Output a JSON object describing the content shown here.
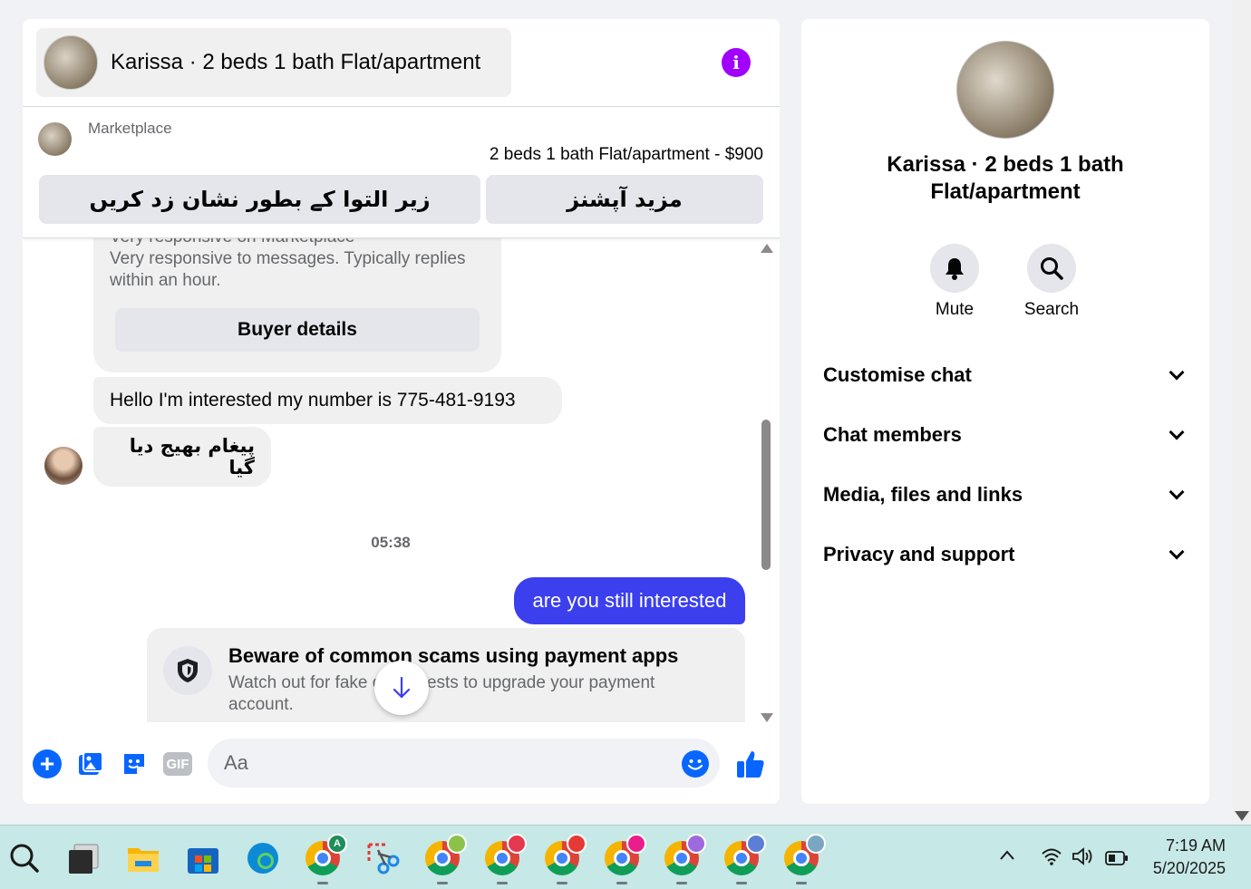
{
  "chat": {
    "header_title": "Karissa · 2 beds 1 bath Flat/apartment",
    "listing": {
      "source_label": "Marketplace",
      "title_price": "2 beds 1 bath Flat/apartment - $900",
      "mark_sold_label": "زیر التوا کے بطور نشان زد کریں",
      "more_options_label": "مزید آپشنز"
    },
    "seller_card": {
      "cut_line": "Very responsive on Marketplace",
      "responsiveness": "Very responsive to messages. Typically replies within an hour.",
      "buyer_details_label": "Buyer details"
    },
    "messages": [
      {
        "from": "them",
        "text": "Hello I'm interested my number is 775-481-9193"
      },
      {
        "from": "them",
        "text": "پیغام بھیج دیا گیا"
      }
    ],
    "timestamp": "05:38",
    "my_message": "are you still interested",
    "scam_warning": {
      "title": "Beware of common scams using payment apps",
      "text": "Watch out for fake      or requests to upgrade your payment account."
    },
    "composer": {
      "placeholder": "Aa",
      "gif_label": "GIF"
    }
  },
  "info_panel": {
    "title": "Karissa · 2 beds 1 bath Flat/apartment",
    "actions": [
      {
        "label": "Mute",
        "icon": "bell-icon"
      },
      {
        "label": "Search",
        "icon": "search-icon"
      }
    ],
    "sections": [
      "Customise chat",
      "Chat members",
      "Media, files and links",
      "Privacy and support"
    ]
  },
  "taskbar": {
    "time": "7:19 AM",
    "date": "5/20/2025",
    "apps": [
      "search-icon",
      "task-view-icon",
      "file-explorer-icon",
      "store-icon",
      "edge-icon",
      "chrome-icon",
      "snipping-tool-icon",
      "chrome-icon",
      "chrome-icon",
      "chrome-icon",
      "chrome-icon",
      "chrome-icon",
      "chrome-icon",
      "chrome-icon"
    ],
    "first_chrome_badge": "A"
  },
  "colors": {
    "accent_blue": "#0866ff",
    "outgoing_bubble": "#3b3fee",
    "info_purple": "#a100ff",
    "taskbar": "#c6e8e6"
  }
}
